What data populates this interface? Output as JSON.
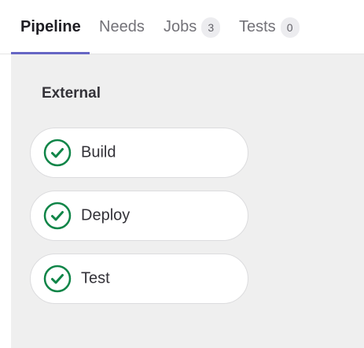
{
  "tabs": [
    {
      "label": "Pipeline",
      "active": true
    },
    {
      "label": "Needs",
      "active": false
    },
    {
      "label": "Jobs",
      "count": "3",
      "active": false
    },
    {
      "label": "Tests",
      "count": "0",
      "active": false
    }
  ],
  "stage": {
    "title": "External",
    "jobs": [
      {
        "name": "Build",
        "status": "success",
        "icon": "check-circle-icon"
      },
      {
        "name": "Deploy",
        "status": "success",
        "icon": "check-circle-icon"
      },
      {
        "name": "Test",
        "status": "success",
        "icon": "check-circle-icon"
      }
    ]
  },
  "colors": {
    "active_underline": "#6666c4",
    "success": "#108548",
    "panel_bg": "#efefef"
  }
}
